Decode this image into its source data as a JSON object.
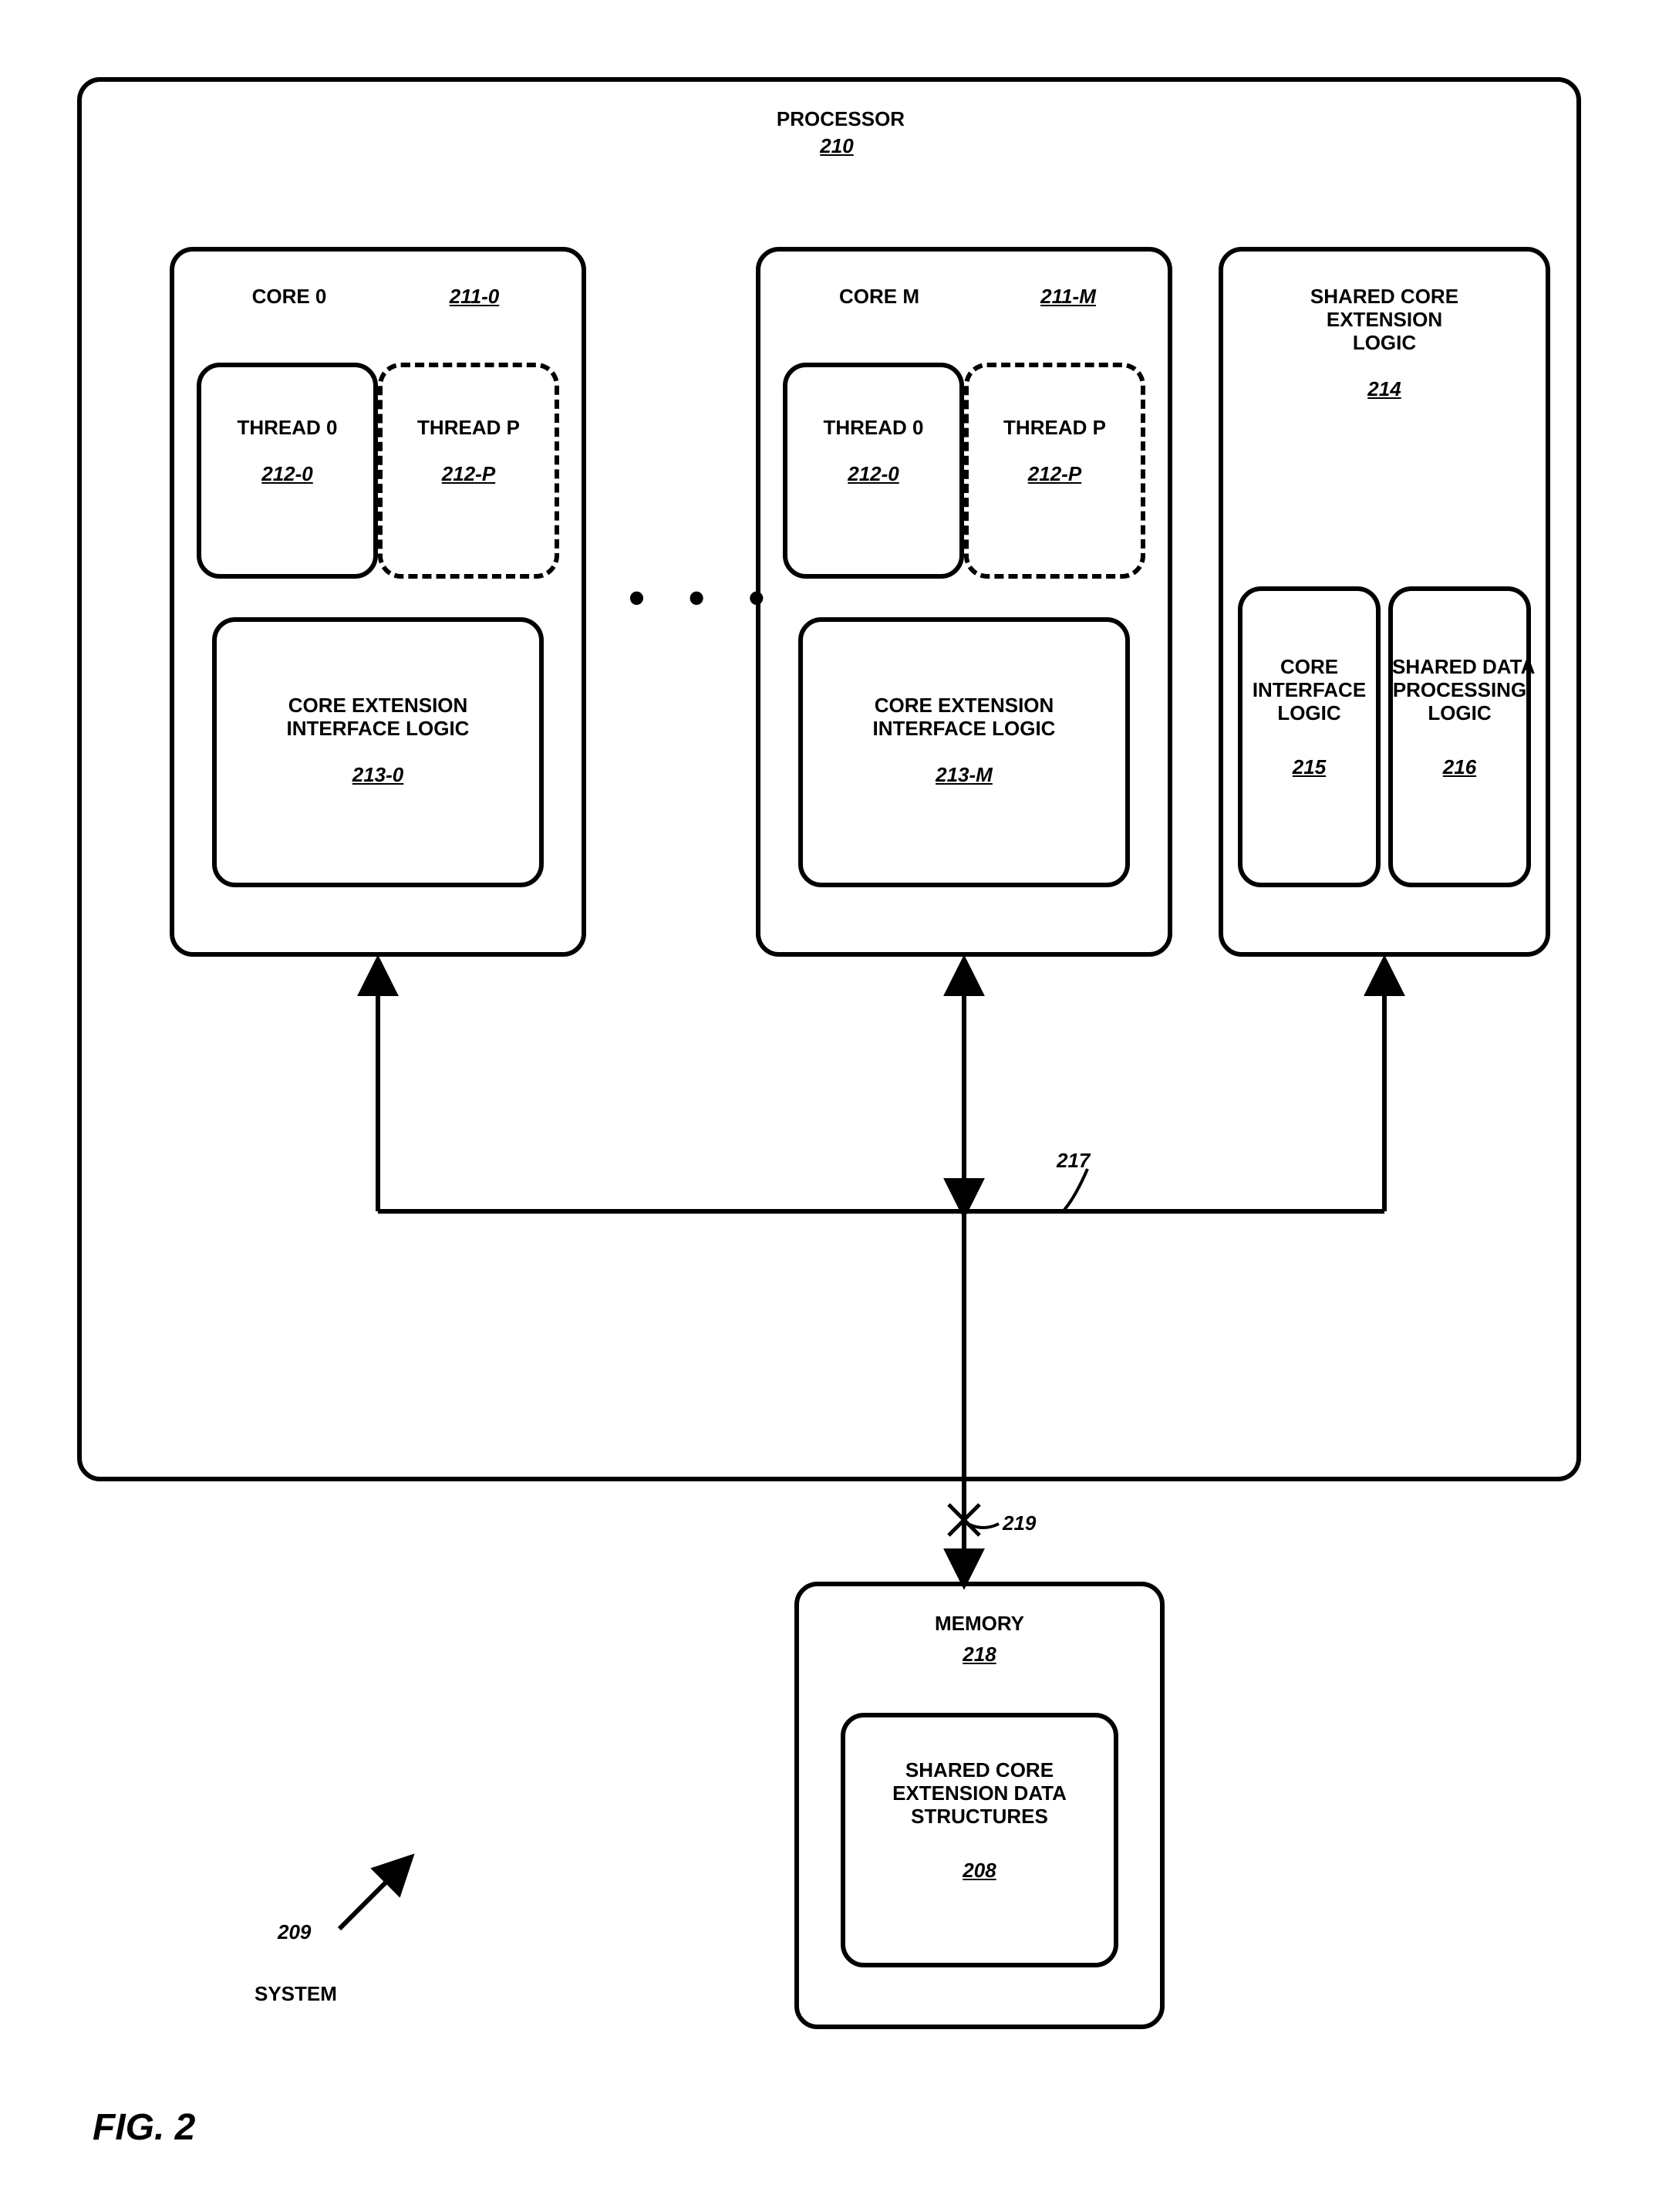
{
  "processor": {
    "title": "PROCESSOR",
    "ref": "210"
  },
  "core0": {
    "title": "CORE 0",
    "ref": "211-0",
    "thread0": {
      "title": "THREAD 0",
      "ref": "212-0"
    },
    "threadP": {
      "title": "THREAD P",
      "ref": "212-P"
    },
    "ceil": {
      "title": "CORE EXTENSION\nINTERFACE LOGIC",
      "ref": "213-0"
    }
  },
  "coreM": {
    "title": "CORE M",
    "ref": "211-M",
    "thread0": {
      "title": "THREAD 0",
      "ref": "212-0"
    },
    "threadP": {
      "title": "THREAD P",
      "ref": "212-P"
    },
    "ceil": {
      "title": "CORE EXTENSION\nINTERFACE LOGIC",
      "ref": "213-M"
    }
  },
  "shared": {
    "title": "SHARED CORE\nEXTENSION\nLOGIC",
    "ref": "214",
    "cil": {
      "title": "CORE\nINTERFACE\nLOGIC",
      "ref": "215"
    },
    "sdp": {
      "title": "SHARED DATA\nPROCESSING\nLOGIC",
      "ref": "216"
    }
  },
  "memory": {
    "title": "MEMORY",
    "ref": "218",
    "inner": {
      "title": "SHARED CORE\nEXTENSION DATA\nSTRUCTURES",
      "ref": "208"
    }
  },
  "wires": {
    "bus_217": "217",
    "bus_219": "219"
  },
  "system": {
    "label": "SYSTEM",
    "ref": "209"
  },
  "figure": "FIG. 2"
}
